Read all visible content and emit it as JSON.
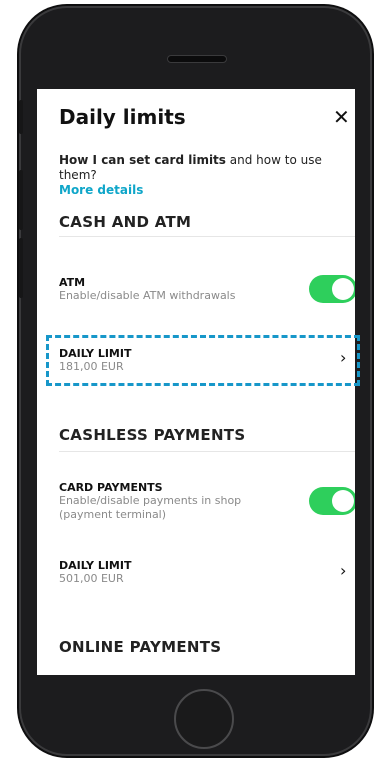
{
  "header": {
    "title": "Daily limits",
    "close_glyph": "✕"
  },
  "info": {
    "bold": "How I can set card limits",
    "rest": " and how to use them?",
    "link": "More details"
  },
  "sections": {
    "cash_atm": "CASH AND ATM",
    "cashless": "CASHLESS PAYMENTS",
    "online": "ONLINE PAYMENTS"
  },
  "atm": {
    "title": "ATM",
    "subtitle": "Enable/disable ATM withdrawals",
    "enabled": true
  },
  "atm_limit": {
    "title": "DAILY LIMIT",
    "value": "181,00 EUR"
  },
  "card_payments": {
    "title": "CARD PAYMENTS",
    "subtitle": "Enable/disable payments in shop (payment terminal)",
    "enabled": true
  },
  "card_limit": {
    "title": "DAILY LIMIT",
    "value": "501,00 EUR"
  },
  "chevron_glyph": "›",
  "colors": {
    "accent_link": "#0fa6c9",
    "toggle_on": "#2ecf5c",
    "highlight": "#1797c9"
  }
}
